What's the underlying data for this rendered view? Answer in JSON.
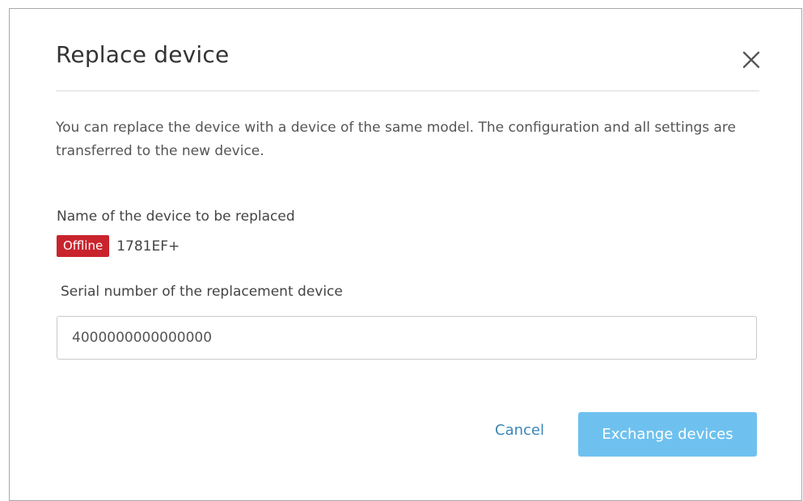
{
  "dialog": {
    "title": "Replace device",
    "description": "You can replace the device with a device of the same model. The configuration and all settings are transferred to the new device.",
    "device_label": "Name of the device to be replaced",
    "status_badge": "Offline",
    "device_name": "1781EF+",
    "serial_label": "Serial number of the replacement device",
    "serial_value": "4000000000000000",
    "cancel_label": "Cancel",
    "exchange_label": "Exchange devices"
  },
  "colors": {
    "badge": "#c9242d",
    "primary_button": "#6ec1ef",
    "link": "#3d86b8"
  },
  "icons": {
    "close": "close-icon"
  }
}
